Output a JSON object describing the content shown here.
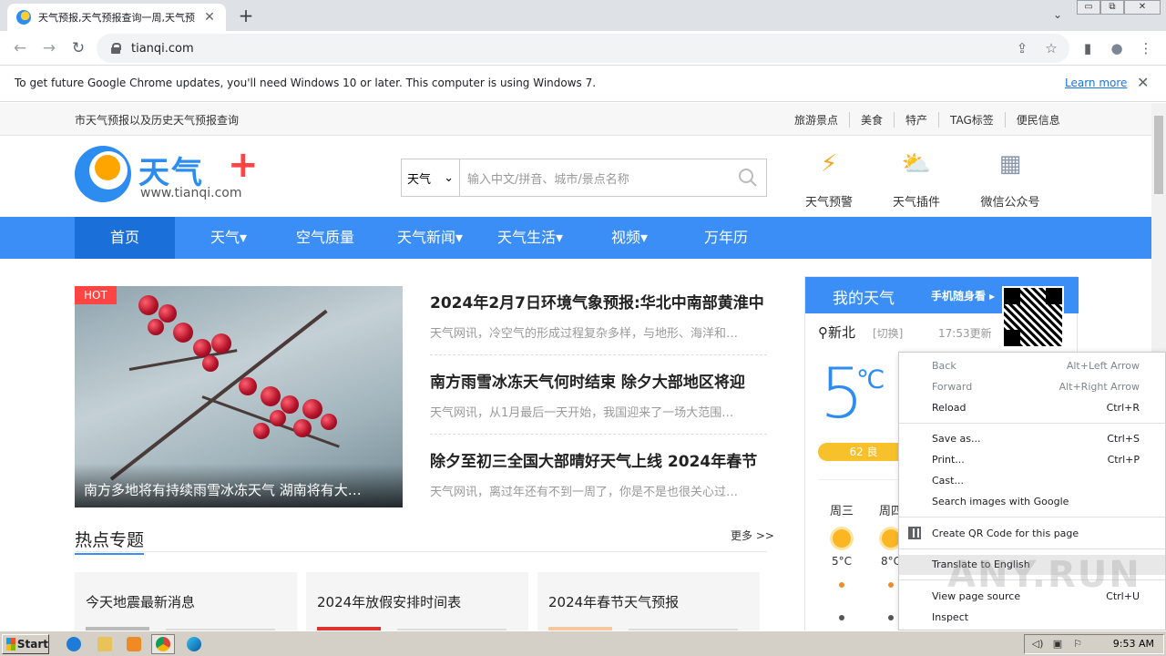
{
  "browser": {
    "tab_title": "天气预报,天气预报查询一周,天气预",
    "tab_close": "✕",
    "new_tab": "+",
    "tab_search": "⌄",
    "window_buttons": [
      "▭",
      "⧉",
      "✕"
    ],
    "url": "tianqi.com",
    "nav": {
      "back": "←",
      "forward": "→",
      "reload": "↻"
    },
    "toolbar_icons": {
      "share": "⇪",
      "bookmark": "☆",
      "sidebar": "▮",
      "profile": "●",
      "menu": "⋮"
    }
  },
  "infobar": {
    "message": "To get future Google Chrome updates, you'll need Windows 10 or later. This computer is using Windows 7.",
    "learn_more": "Learn more",
    "close": "✕"
  },
  "site": {
    "topbar_left": "市天气预报以及历史天气预报查询",
    "topbar_links": [
      "旅游景点",
      "美食",
      "特产",
      "TAG标签",
      "便民信息"
    ],
    "logo_name": "天气",
    "logo_plus": "+",
    "logo_domain": "www.tianqi.com",
    "search": {
      "select_value": "天气",
      "select_arrow": "⌄",
      "placeholder": "输入中文/拼音、城市/景点名称"
    },
    "quick_icons": [
      {
        "label": "天气预警",
        "icon": "⚡"
      },
      {
        "label": "天气插件",
        "icon": "⛅"
      },
      {
        "label": "微信公众号",
        "icon": "▦"
      }
    ],
    "nav": [
      "首页",
      "天气▾",
      "空气质量",
      "天气新闻▾",
      "天气生活▾",
      "视频▾",
      "万年历"
    ],
    "featured": {
      "badge": "HOT",
      "caption": "南方多地将有持续雨雪冰冻天气 湖南将有大…"
    },
    "news": [
      {
        "headline": "2024年2月7日环境气象预报:华北中南部黄淮中",
        "summary": "天气网讯，冷空气的形成过程复杂多样，与地形、海洋和…"
      },
      {
        "headline": "南方雨雪冰冻天气何时结束 除夕大部地区将迎",
        "summary": "天气网讯，从1月最后一天开始，我国迎来了一场大范围…"
      },
      {
        "headline": "除夕至初三全国大部晴好天气上线 2024年春节",
        "summary": "天气网讯，离过年还有不到一周了，你是不是也很关心过…"
      }
    ],
    "hot_topics": {
      "title": "热点专题",
      "more": "更多 >>",
      "cards": [
        "今天地震最新消息",
        "2024年放假安排时间表",
        "2024年春节天气预报"
      ]
    },
    "my_weather": {
      "title": "我的天气",
      "mobile": "手机随身看 ▸",
      "city": "新北",
      "switch": "[切换]",
      "updated": "17:53更新",
      "temp": "5",
      "unit": "℃",
      "aqi": "62 良",
      "days": [
        {
          "day": "周三",
          "temp": "5°C"
        },
        {
          "day": "周四",
          "temp": "8°C"
        }
      ]
    }
  },
  "context_menu": {
    "items": [
      {
        "label": "Back",
        "shortcut": "Alt+Left Arrow",
        "disabled": true
      },
      {
        "label": "Forward",
        "shortcut": "Alt+Right Arrow",
        "disabled": true
      },
      {
        "label": "Reload",
        "shortcut": "Ctrl+R"
      },
      {
        "label": "Save as...",
        "shortcut": "Ctrl+S"
      },
      {
        "label": "Print...",
        "shortcut": "Ctrl+P"
      },
      {
        "label": "Cast...",
        "shortcut": ""
      },
      {
        "label": "Search images with Google",
        "shortcut": ""
      },
      {
        "label": "Create QR Code for this page",
        "shortcut": ""
      },
      {
        "label": "Translate to English",
        "shortcut": ""
      },
      {
        "label": "View page source",
        "shortcut": "Ctrl+U"
      },
      {
        "label": "Inspect",
        "shortcut": ""
      }
    ]
  },
  "watermark": "ANY.RUN",
  "taskbar": {
    "start": "Start",
    "clock": "9:53 AM",
    "tray_icons": [
      "◁)",
      "▣",
      "⚐"
    ]
  }
}
